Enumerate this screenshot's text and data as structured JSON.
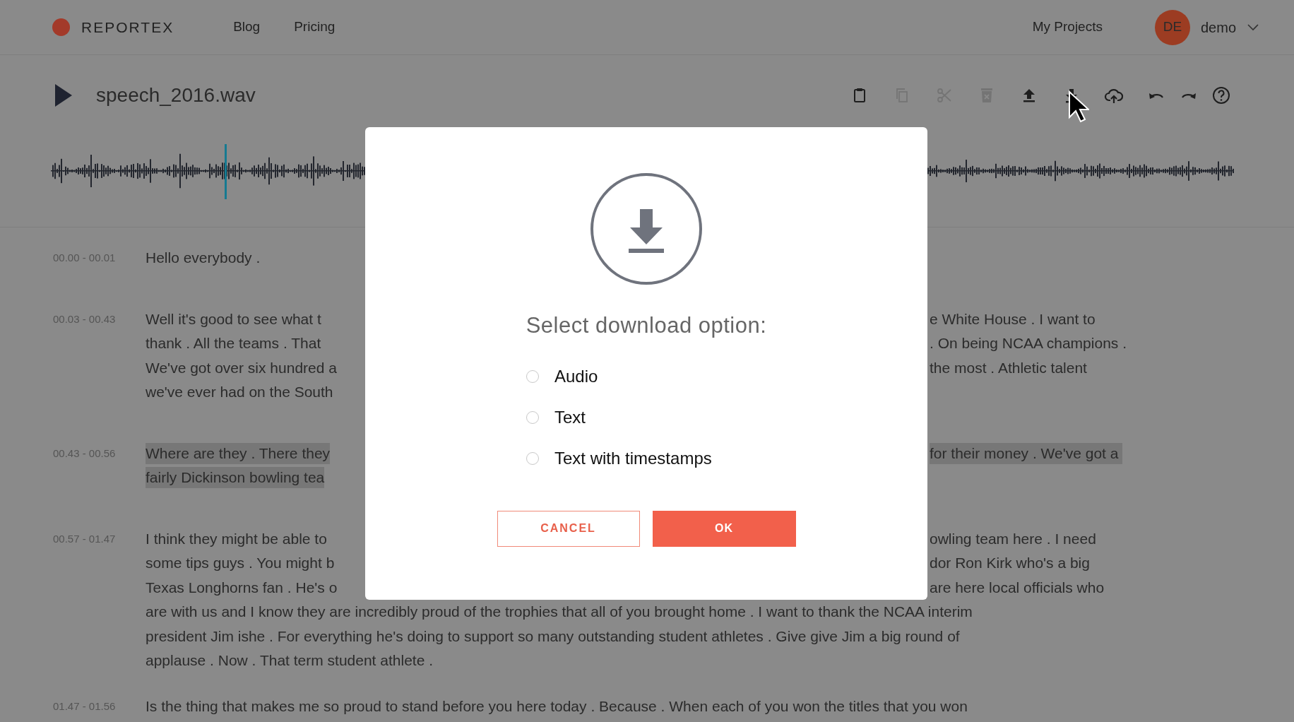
{
  "header": {
    "brand": "REPORTEX",
    "nav": [
      "Blog",
      "Pricing"
    ],
    "projects_link": "My Projects",
    "user": {
      "initials": "DE",
      "name": "demo"
    }
  },
  "file": {
    "name": "speech_2016.wav"
  },
  "toolbar": [
    {
      "kind": "paste",
      "disabled": false
    },
    {
      "kind": "copy",
      "disabled": true
    },
    {
      "kind": "cut",
      "disabled": true
    },
    {
      "kind": "delete",
      "disabled": true
    },
    {
      "kind": "upload",
      "disabled": false
    },
    {
      "kind": "download",
      "disabled": false
    },
    {
      "kind": "cloud",
      "disabled": false
    },
    {
      "kind": "undo",
      "disabled": false
    },
    {
      "kind": "redo",
      "disabled": false
    },
    {
      "kind": "help",
      "disabled": false
    }
  ],
  "transcript": [
    {
      "time": "00.00 - 00.01",
      "highlighted": false,
      "lines": [
        {
          "left": "Hello everybody ."
        }
      ]
    },
    {
      "time": "00.03 - 00.43",
      "highlighted": false,
      "lines": [
        {
          "left": "Well it's good to see what t",
          "right": "e White House . I want to"
        },
        {
          "left": "thank . All the teams . That",
          "right": ". On being NCAA champions ."
        },
        {
          "left": "We've got over six hundred a",
          "right": "the most . Athletic talent"
        },
        {
          "left": "we've ever had on the South"
        }
      ]
    },
    {
      "time": "00.43 - 00.56",
      "highlighted": true,
      "lines": [
        {
          "left": "Where are they . There they",
          "right": "for their money . We've got a"
        },
        {
          "left": "fairly Dickinson bowling tea"
        }
      ]
    },
    {
      "time": "00.57 - 01.47",
      "highlighted": false,
      "lines": [
        {
          "left": "I think they might be able to",
          "right": "owling team here . I need"
        },
        {
          "left": "some tips guys . You might b",
          "right": "dor Ron Kirk who's a big"
        },
        {
          "left": "Texas Longhorns fan . He's o",
          "right": "are here local officials who"
        },
        {
          "left": "are with us and I know they are incredibly proud of the trophies that all of you brought home . I want to thank the NCAA interim"
        },
        {
          "left": "president Jim ishe . For everything he's doing to support so many outstanding student athletes . Give give Jim a big round of"
        },
        {
          "left": "applause . Now . That term student athlete ."
        }
      ]
    },
    {
      "time": "01.47 - 01.56",
      "highlighted": false,
      "lines": [
        {
          "left": "Is the thing that makes me so proud to stand before you here today . Because . When each of you won the titles that you won"
        }
      ]
    }
  ],
  "dialog": {
    "title": "Select download option:",
    "options": [
      {
        "label": "Audio",
        "selected": false
      },
      {
        "label": "Text",
        "selected": false
      },
      {
        "label": "Text with timestamps",
        "selected": false
      }
    ],
    "cancel": "CANCEL",
    "ok": "OK"
  }
}
